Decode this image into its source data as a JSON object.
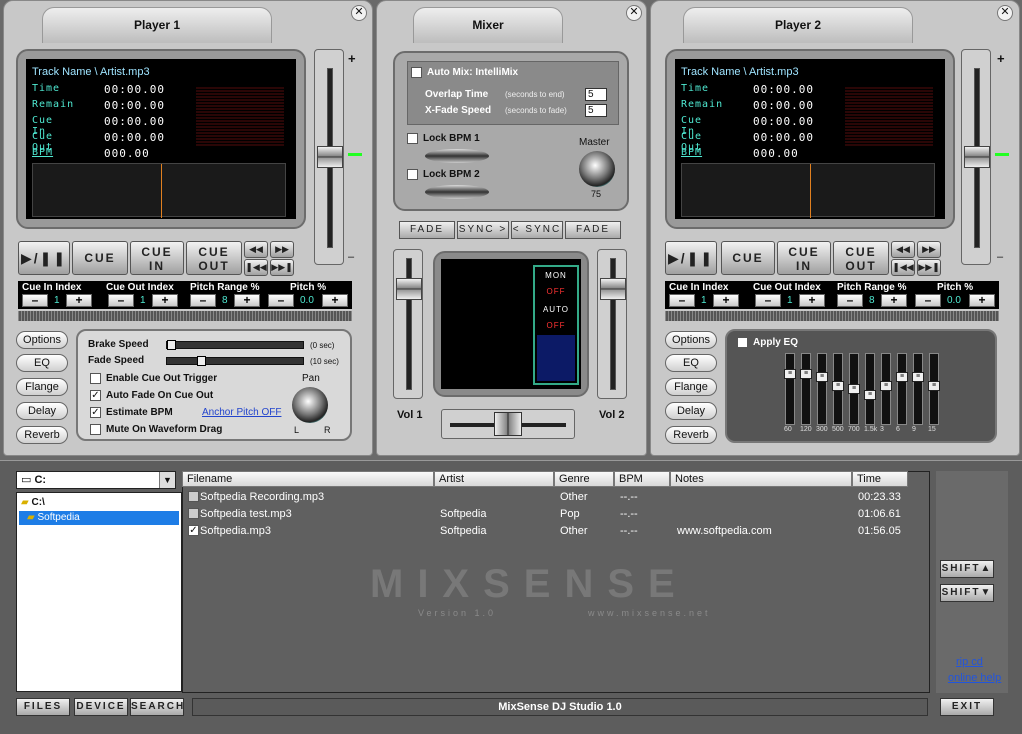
{
  "player1": {
    "title": "Player 1",
    "track": "Track Name \\ Artist.mp3",
    "rows": [
      {
        "label": "Time",
        "value": "00:00.00"
      },
      {
        "label": "Remain",
        "value": "00:00.00"
      },
      {
        "label": "Cue In",
        "value": "00:00.00"
      },
      {
        "label": "Cue Out",
        "value": "00:00.00"
      },
      {
        "label": "BPM",
        "value": "000.00"
      }
    ],
    "cue_in_label": "Cue In Index",
    "cue_in_val": "1",
    "cue_out_label": "Cue Out Index",
    "cue_out_val": "1",
    "pitch_range_label": "Pitch Range %",
    "pitch_range_val": "8",
    "pitch_label": "Pitch %",
    "pitch_val": "0.0",
    "btn_cue": "CUE",
    "btn_cuein": "CUE",
    "btn_cuein2": "IN",
    "btn_cueout": "CUE",
    "btn_cueout2": "OUT",
    "brake_label": "Brake Speed",
    "brake_val": "(0 sec)",
    "fade_label": "Fade Speed",
    "fade_val": "(10 sec)",
    "opt1": "Enable Cue Out Trigger",
    "opt2": "Auto Fade On Cue Out",
    "opt3": "Estimate BPM",
    "opt4": "Mute On Waveform Drag",
    "anchor": "Anchor Pitch OFF",
    "pan": "Pan",
    "pan_l": "L",
    "pan_r": "R"
  },
  "player2": {
    "title": "Player 2",
    "track": "Track Name \\ Artist.mp3",
    "rows": [
      {
        "label": "Time",
        "value": "00:00.00"
      },
      {
        "label": "Remain",
        "value": "00:00.00"
      },
      {
        "label": "Cue In",
        "value": "00:00.00"
      },
      {
        "label": "Cue Out",
        "value": "00:00.00"
      },
      {
        "label": "BPM",
        "value": "000.00"
      }
    ],
    "cue_in_label": "Cue In Index",
    "cue_in_val": "1",
    "cue_out_label": "Cue Out Index",
    "cue_out_val": "1",
    "pitch_range_label": "Pitch Range %",
    "pitch_range_val": "8",
    "pitch_label": "Pitch %",
    "pitch_val": "0.0",
    "btn_cue": "CUE",
    "btn_cuein": "CUE",
    "btn_cuein2": "IN",
    "btn_cueout": "CUE",
    "btn_cueout2": "OUT",
    "apply_eq": "Apply EQ",
    "eq_bands": [
      {
        "label": "60",
        "level": 0.75
      },
      {
        "label": "120",
        "level": 0.75
      },
      {
        "label": "300",
        "level": 0.7
      },
      {
        "label": "500",
        "level": 0.55
      },
      {
        "label": "700",
        "level": 0.5
      },
      {
        "label": "1.5k",
        "level": 0.4
      },
      {
        "label": "3",
        "level": 0.55
      },
      {
        "label": "6",
        "level": 0.7
      },
      {
        "label": "9",
        "level": 0.7
      },
      {
        "label": "15",
        "level": 0.55
      }
    ]
  },
  "side_buttons": [
    "Options",
    "EQ",
    "Flange",
    "Delay",
    "Reverb"
  ],
  "pitch_plus": "+",
  "pitch_minus": "–",
  "mixer": {
    "title": "Mixer",
    "automix": "Auto Mix: IntelliMix",
    "overlap": "Overlap Time",
    "overlap_hint": "(seconds to end)",
    "overlap_val": "5",
    "xfade": "X-Fade Speed",
    "xfade_hint": "(seconds to fade)",
    "xfade_val": "5",
    "lock1": "Lock BPM 1",
    "lock2": "Lock BPM 2",
    "master": "Master",
    "master_val": "75",
    "fade_l": "FADE",
    "sync_r": "SYNC >",
    "sync_l": "< SYNC",
    "fade_r": "FADE",
    "mon": "MON",
    "mon_state": "OFF",
    "auto": "AUTO",
    "auto_state": "OFF",
    "vol1": "Vol 1",
    "vol2": "Vol 2"
  },
  "browser": {
    "drive": "C:",
    "tree": [
      "C:\\",
      "Softpedia"
    ],
    "columns": [
      "Filename",
      "Artist",
      "Genre",
      "BPM",
      "Notes",
      "Time"
    ],
    "rows": [
      {
        "file": "Softpedia Recording.mp3",
        "artist": "",
        "genre": "Other",
        "bpm": "--.--",
        "notes": "",
        "time": "00:23.33",
        "checked": false
      },
      {
        "file": "Softpedia test.mp3",
        "artist": "Softpedia",
        "genre": "Pop",
        "bpm": "--.--",
        "notes": "",
        "time": "01:06.61",
        "checked": false
      },
      {
        "file": "Softpedia.mp3",
        "artist": "Softpedia",
        "genre": "Other",
        "bpm": "--.--",
        "notes": "www.softpedia.com",
        "time": "01:56.05",
        "checked": true
      }
    ],
    "logo": "MIXSENSE",
    "version": "Version 1.0",
    "site": "www.mixsense.net",
    "shift_up": "SHIFT▲",
    "shift_down": "SHIFT▼",
    "rip": "rip cd",
    "help": "online help",
    "files": "FILES",
    "device": "DEVICE",
    "search": "SEARCH",
    "status": "MixSense DJ Studio 1.0",
    "exit": "EXIT"
  }
}
